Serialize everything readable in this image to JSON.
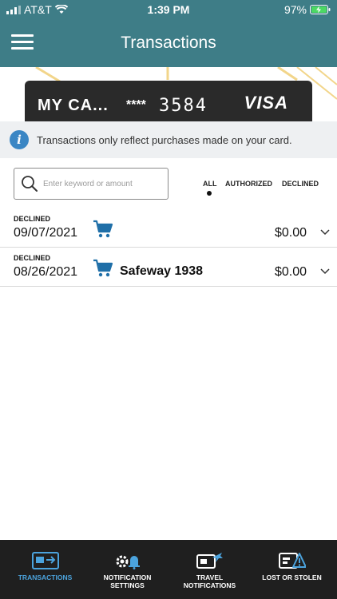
{
  "status_bar": {
    "carrier": "AT&T",
    "time": "1:39 PM",
    "battery": "97%"
  },
  "header": {
    "title": "Transactions"
  },
  "card": {
    "name": "MY CA...",
    "mask": "****",
    "last4": "3584",
    "brand": "VISA"
  },
  "info": {
    "message": "Transactions only reflect purchases made on your card."
  },
  "search": {
    "placeholder": "Enter keyword or amount",
    "value": ""
  },
  "filters": {
    "items": [
      {
        "label": "ALL",
        "selected": true
      },
      {
        "label": "AUTHORIZED",
        "selected": false
      },
      {
        "label": "DECLINED",
        "selected": false
      }
    ]
  },
  "transactions": [
    {
      "status": "DECLINED",
      "date": "09/07/2021",
      "merchant": "",
      "amount": "$0.00",
      "icon": "cart-icon"
    },
    {
      "status": "DECLINED",
      "date": "08/26/2021",
      "merchant": "Safeway 1938",
      "amount": "$0.00",
      "icon": "cart-icon"
    }
  ],
  "tab_bar": {
    "tabs": [
      {
        "label_line1": "TRANSACTIONS",
        "label_line2": "",
        "icon": "transactions-icon",
        "active": true
      },
      {
        "label_line1": "NOTIFICATION",
        "label_line2": "SETTINGS",
        "icon": "notification-settings-icon",
        "active": false
      },
      {
        "label_line1": "TRAVEL",
        "label_line2": "NOTIFICATIONS",
        "icon": "travel-notifications-icon",
        "active": false
      },
      {
        "label_line1": "LOST OR STOLEN",
        "label_line2": "",
        "icon": "lost-or-stolen-icon",
        "active": false
      }
    ]
  },
  "colors": {
    "header_bg": "#3e7d87",
    "accent_blue": "#3a86c4",
    "tab_bar_bg": "#1f1f1f",
    "active_tab": "#4ba3dd",
    "card_bg": "#2a2a2a"
  }
}
